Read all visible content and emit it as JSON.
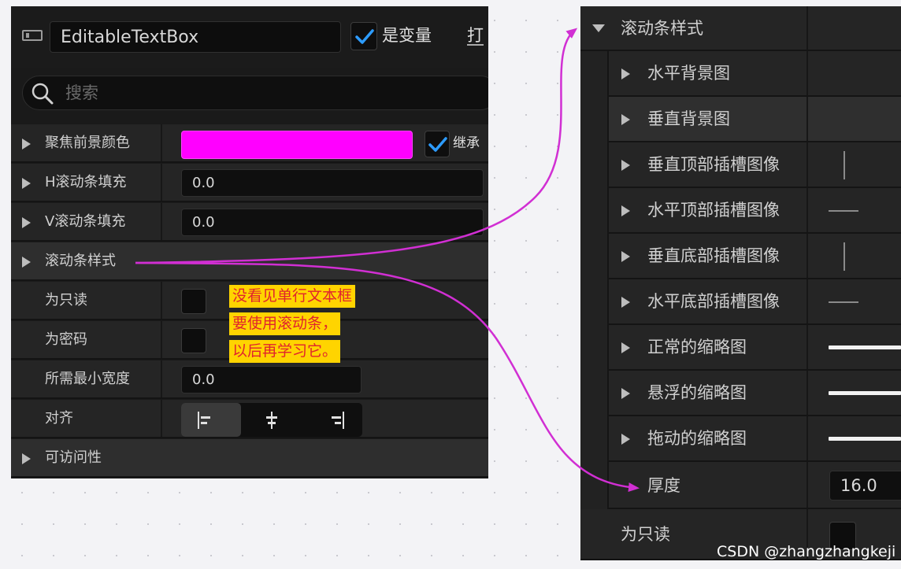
{
  "left_panel": {
    "widget_name": "EditableTextBox",
    "is_variable_label": "是变量",
    "is_variable_checked": true,
    "clipped_button_label": "打",
    "search_placeholder": "搜索",
    "properties": [
      {
        "label": "聚焦前景颜色",
        "expandable": true,
        "type": "color",
        "color": "#ff00ff",
        "inherit_label": "继承",
        "inherit_checked": true
      },
      {
        "label": "H滚动条填充",
        "expandable": true,
        "type": "number",
        "value": "0.0"
      },
      {
        "label": "V滚动条填充",
        "expandable": true,
        "type": "number",
        "value": "0.0"
      },
      {
        "label": "滚动条样式",
        "expandable": true,
        "type": "group"
      },
      {
        "label": "为只读",
        "expandable": false,
        "type": "checkbox",
        "checked": false
      },
      {
        "label": "为密码",
        "expandable": false,
        "type": "checkbox",
        "checked": false
      },
      {
        "label": "所需最小宽度",
        "expandable": false,
        "type": "number",
        "value": "0.0"
      },
      {
        "label": "对齐",
        "expandable": false,
        "type": "alignment",
        "options": [
          "left-align-icon",
          "center-align-icon",
          "right-align-icon"
        ],
        "selected": 0
      },
      {
        "label": "可访问性",
        "expandable": true,
        "type": "group"
      }
    ]
  },
  "right_panel": {
    "group_label": "滚动条样式",
    "items": [
      {
        "label": "水平背景图",
        "expandable": true,
        "preview": "none"
      },
      {
        "label": "垂直背景图",
        "expandable": true,
        "preview": "none"
      },
      {
        "label": "垂直顶部插槽图像",
        "expandable": true,
        "preview": "vertical-line"
      },
      {
        "label": "水平顶部插槽图像",
        "expandable": true,
        "preview": "horizontal-line"
      },
      {
        "label": "垂直底部插槽图像",
        "expandable": true,
        "preview": "vertical-line"
      },
      {
        "label": "水平底部插槽图像",
        "expandable": true,
        "preview": "horizontal-line"
      },
      {
        "label": "正常的缩略图",
        "expandable": true,
        "preview": "thumb-bar"
      },
      {
        "label": "悬浮的缩略图",
        "expandable": true,
        "preview": "thumb-bar"
      },
      {
        "label": "拖动的缩略图",
        "expandable": true,
        "preview": "thumb-bar"
      }
    ],
    "thickness_label": "厚度",
    "thickness_value": "16.0",
    "readonly_label": "为只读"
  },
  "annotation": {
    "lines": [
      "没看见单行文本框",
      "要使用滚动条，",
      "以后再学习它。"
    ],
    "arrow_color": "#d12fd3",
    "note_background": "#ffd400",
    "note_text_color": "#e0232d"
  },
  "watermark": "CSDN @zhangzhangkeji"
}
